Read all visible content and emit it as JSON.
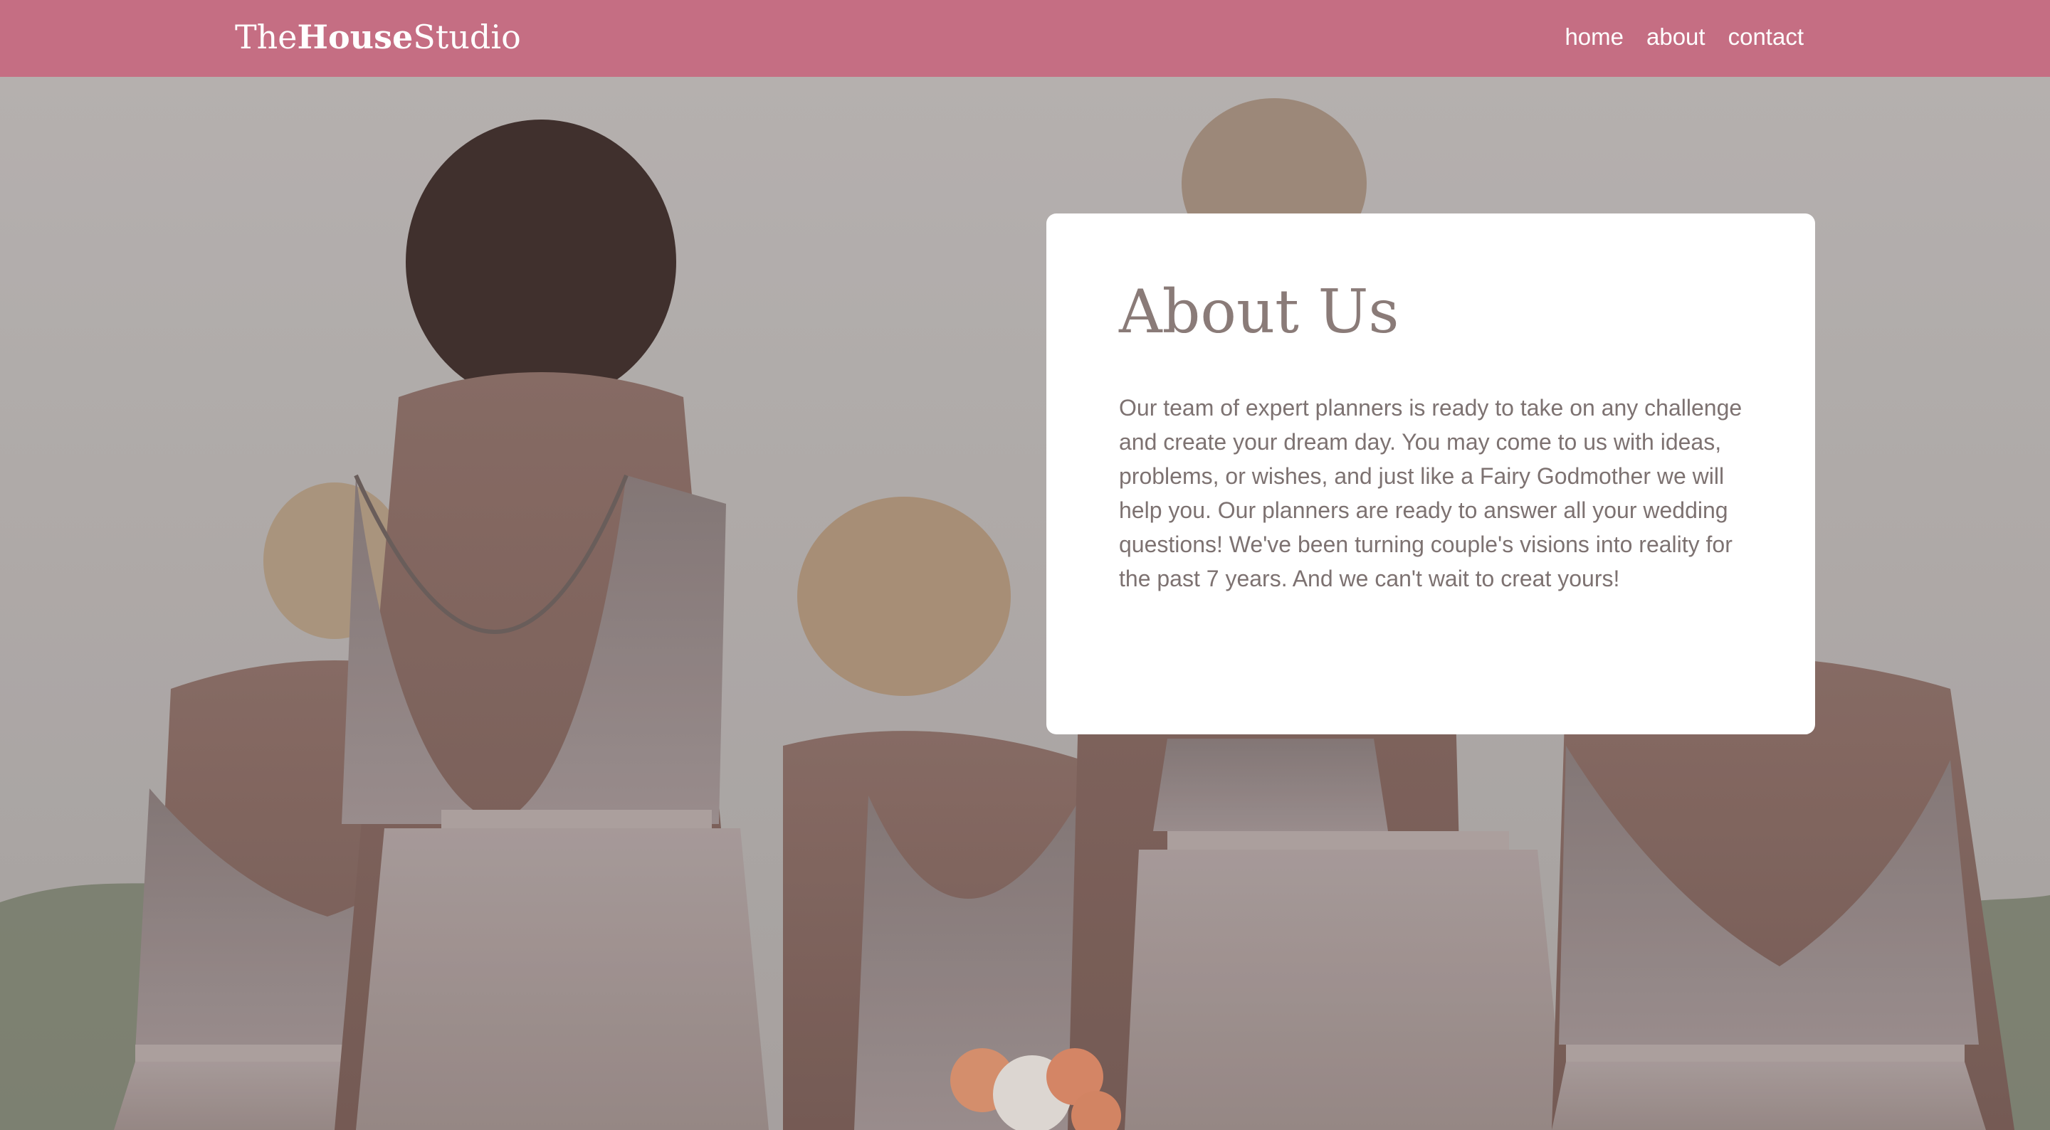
{
  "header": {
    "logo": {
      "prefix": "The",
      "bold": "House",
      "suffix": "Studio"
    },
    "nav": [
      {
        "label": "home"
      },
      {
        "label": "about"
      },
      {
        "label": "contact"
      }
    ],
    "colors": {
      "header_bg": "#c56e83",
      "header_text": "#ffffff"
    }
  },
  "hero": {
    "image_icon": "bridesmaids-photo"
  },
  "about": {
    "title": "About Us",
    "body": "Our team of expert planners is ready to take on any challenge and create your dream day. You may come to us with ideas, problems, or wishes, and just like a Fairy Godmother we will help you. Our planners are ready to answer all your wedding questions! We've been turning couple's visions into reality for the past 7 years. And we can't wait to creat yours!",
    "colors": {
      "title": "#8a7b78",
      "body": "#7d7271"
    }
  }
}
